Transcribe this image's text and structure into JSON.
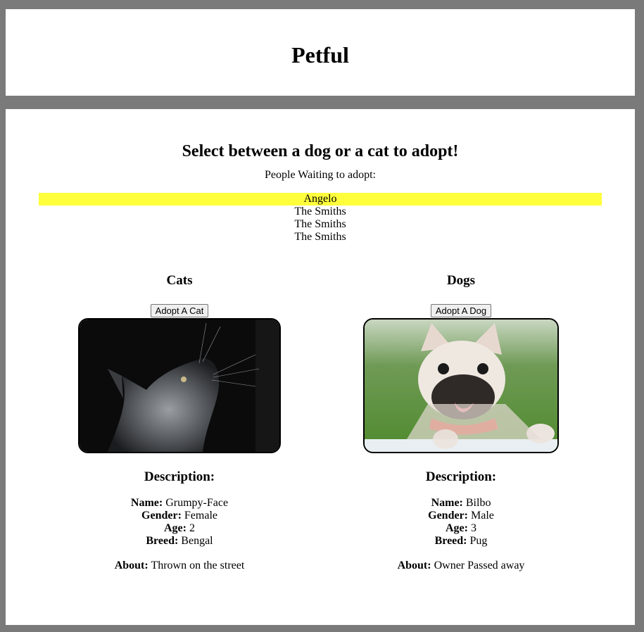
{
  "header": {
    "title": "Petful"
  },
  "main": {
    "heading": "Select between a dog or a cat to adopt!",
    "waiting_label": "People Waiting to adopt:",
    "queue": [
      "Angelo",
      "The Smiths",
      "The Smiths",
      "The Smiths"
    ],
    "highlight_color": "#ffff3c"
  },
  "cats": {
    "title": "Cats",
    "button_label": "Adopt A Cat",
    "image_icon": "cat-photo",
    "description_label": "Description:",
    "labels": {
      "name": "Name:",
      "gender": "Gender:",
      "age": "Age:",
      "breed": "Breed:",
      "about": "About:"
    },
    "name": "Grumpy-Face",
    "gender": "Female",
    "age": "2",
    "breed": "Bengal",
    "about": "Thrown on the street"
  },
  "dogs": {
    "title": "Dogs",
    "button_label": "Adopt A Dog",
    "image_icon": "dog-photo",
    "description_label": "Description:",
    "labels": {
      "name": "Name:",
      "gender": "Gender:",
      "age": "Age:",
      "breed": "Breed:",
      "about": "About:"
    },
    "name": "Bilbo",
    "gender": "Male",
    "age": "3",
    "breed": "Pug",
    "about": "Owner Passed away"
  }
}
